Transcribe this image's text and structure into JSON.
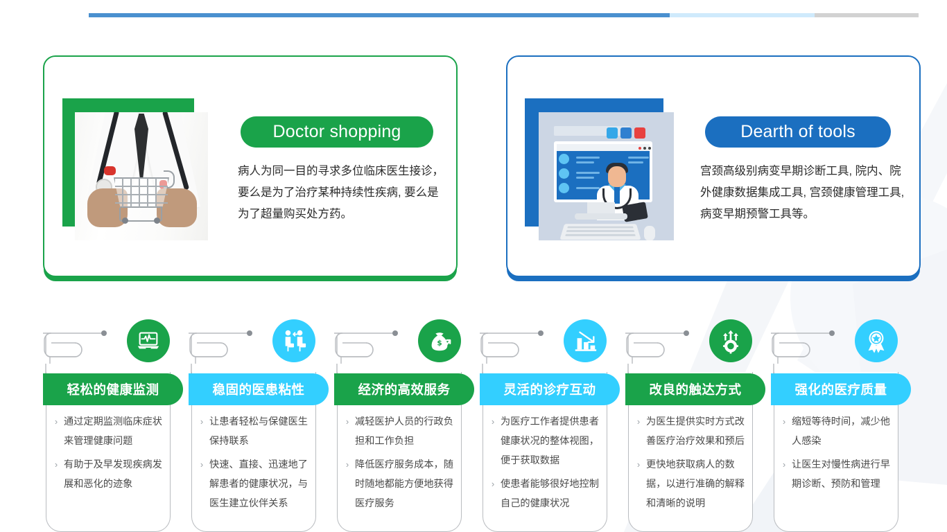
{
  "topbar": {
    "segments": [
      {
        "name": "progress-filled",
        "color": "#4a90cf",
        "width_pct": 70
      },
      {
        "name": "progress-light",
        "color": "#cfeafc",
        "width_pct": 17.5
      },
      {
        "name": "progress-track",
        "color": "#d2d2d2",
        "width_pct": 12.5
      }
    ]
  },
  "top_cards": [
    {
      "id": "doctor-shopping",
      "accent": "#1aa34a",
      "pill_label": "Doctor shopping",
      "body": "病人为同一目的寻求多位临床医生接诊，要么是为了治疗某种持续性疾病, 要么是为了超量购买处方药。",
      "image_alt": "doctor-holding-shopping-cart-photo"
    },
    {
      "id": "dearth-of-tools",
      "accent": "#1b6fc0",
      "pill_label": "Dearth of tools",
      "body": "宫颈高级别病变早期诊断工具, 院内、院外健康数据集成工具, 宫颈健康管理工具, 病变早期预警工具等。",
      "image_alt": "telemedicine-monitor-illustration"
    }
  ],
  "features": [
    {
      "id": "health-monitoring",
      "theme": "green",
      "color": "#1aa34a",
      "icon": "laptop-ecg-icon",
      "title": "轻松的健康监测",
      "bullets": [
        "通过定期监测临床症状来管理健康问题",
        "有助于及早发现疾病发展和恶化的迹象"
      ]
    },
    {
      "id": "doctor-patient-stickiness",
      "theme": "blue",
      "color": "#33cfff",
      "icon": "two-people-exchange-icon",
      "title": "稳固的医患粘性",
      "bullets": [
        "让患者轻松与保健医生保持联系",
        "快速、直接、迅速地了解患者的健康状况，与医生建立伙伴关系"
      ]
    },
    {
      "id": "economic-efficient-service",
      "theme": "green",
      "color": "#1aa34a",
      "icon": "money-bag-growth-icon",
      "title": "经济的高效服务",
      "bullets": [
        "减轻医护人员的行政负担和工作负担",
        "降低医疗服务成本，随时随地都能方便地获得医疗服务"
      ]
    },
    {
      "id": "flexible-diagnosis-interaction",
      "theme": "blue",
      "color": "#33cfff",
      "icon": "declining-bar-chart-icon",
      "title": "灵活的诊疗互动",
      "bullets": [
        "为医疗工作者提供患者健康状况的整体视图，便于获取数据",
        "使患者能够很好地控制自己的健康状况"
      ]
    },
    {
      "id": "improved-reach",
      "theme": "green",
      "color": "#1aa34a",
      "icon": "gear-arrows-up-icon",
      "title": "改良的触达方式",
      "bullets": [
        "为医生提供实时方式改善医疗治疗效果和预后",
        "更快地获取病人的数据，以进行准确的解释和清晰的说明"
      ]
    },
    {
      "id": "enhanced-care-quality",
      "theme": "blue",
      "color": "#33cfff",
      "icon": "award-ribbon-star-icon",
      "title": "强化的医疗质量",
      "bullets": [
        "缩短等待时间，减少他人感染",
        "让医生对慢性病进行早期诊断、预防和管理"
      ]
    }
  ],
  "bullet_marker": "›"
}
